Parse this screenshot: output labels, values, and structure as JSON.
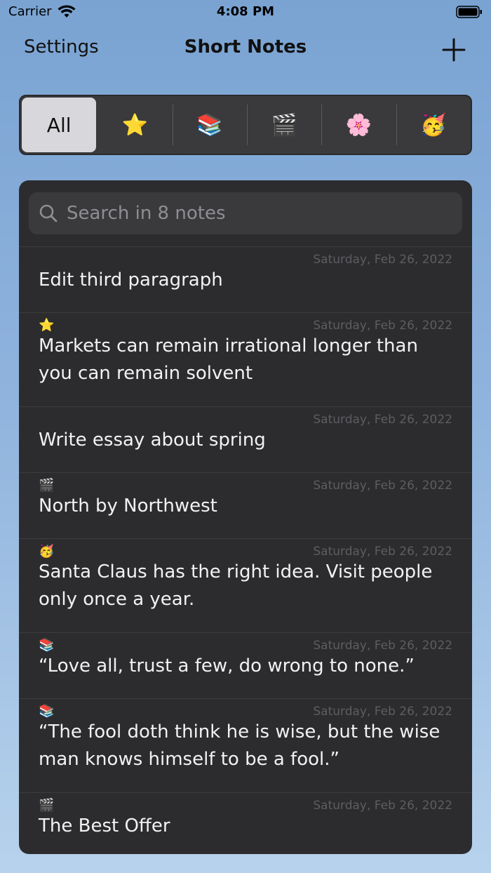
{
  "status_bar": {
    "carrier": "Carrier",
    "time": "4:08 PM"
  },
  "nav": {
    "left_label": "Settings",
    "title": "Short Notes",
    "add_icon": "plus-icon"
  },
  "segments": [
    {
      "label": "All",
      "selected": true
    },
    {
      "label": "⭐"
    },
    {
      "label": "📚"
    },
    {
      "label": "🎬"
    },
    {
      "label": "🌸"
    },
    {
      "label": "🥳"
    }
  ],
  "search": {
    "placeholder": "Search in 8 notes",
    "value": ""
  },
  "notes": [
    {
      "icon": "",
      "date": "Saturday, Feb 26, 2022",
      "text": "Edit third paragraph"
    },
    {
      "icon": "⭐",
      "date": "Saturday, Feb 26, 2022",
      "text": "Markets can remain irrational longer than you can remain solvent"
    },
    {
      "icon": "",
      "date": "Saturday, Feb 26, 2022",
      "text": "Write essay about spring"
    },
    {
      "icon": "🎬",
      "date": "Saturday, Feb 26, 2022",
      "text": "North by Northwest"
    },
    {
      "icon": "🥳",
      "date": "Saturday, Feb 26, 2022",
      "text": "Santa Claus has the right idea. Visit people only once a year."
    },
    {
      "icon": "📚",
      "date": "Saturday, Feb 26, 2022",
      "text": "“Love all, trust a few, do wrong to none.”"
    },
    {
      "icon": "📚",
      "date": "Saturday, Feb 26, 2022",
      "text": "“The fool doth think he is wise, but the wise man knows himself to be a fool.”"
    },
    {
      "icon": "🎬",
      "date": "Saturday, Feb 26, 2022",
      "text": "The Best Offer"
    }
  ]
}
